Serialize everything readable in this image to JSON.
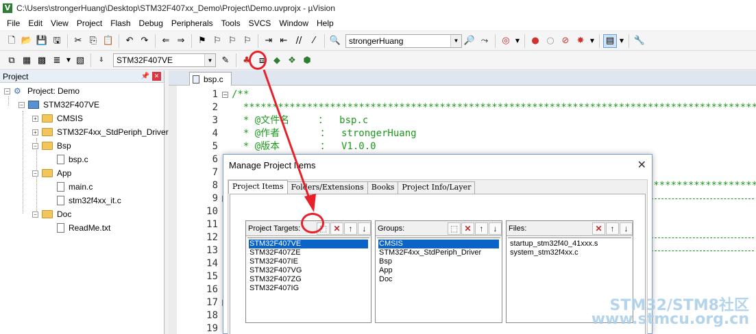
{
  "window": {
    "title": "C:\\Users\\strongerHuang\\Desktop\\STM32F407xx_Demo\\Project\\Demo.uvprojx - µVision"
  },
  "menu": [
    "File",
    "Edit",
    "View",
    "Project",
    "Flash",
    "Debug",
    "Peripherals",
    "Tools",
    "SVCS",
    "Window",
    "Help"
  ],
  "toolbar": {
    "user_combo": "strongerHuang",
    "target_combo": "STM32F407VE"
  },
  "project_panel": {
    "title": "Project",
    "tree": {
      "root": "Project: Demo",
      "target": "STM32F407VE",
      "groups": [
        "CMSIS",
        "STM32F4xx_StdPeriph_Driver",
        "Bsp",
        "App",
        "Doc"
      ],
      "bsp_files": [
        "bsp.c"
      ],
      "app_files": [
        "main.c",
        "stm32f4xx_it.c"
      ],
      "doc_files": [
        "ReadMe.txt"
      ]
    }
  },
  "editor": {
    "tab": "bsp.c",
    "line_numbers": [
      "1",
      "2",
      "3",
      "4",
      "5",
      "6",
      "7",
      "8",
      "9",
      "10",
      "11",
      "12",
      "13",
      "14",
      "15",
      "16",
      "17",
      "18",
      "19"
    ],
    "code": {
      "l1": "/**",
      "l2": "  **********************************************************************************************",
      "l3": "  * @文件名     ：  bsp.c",
      "l4": "  * @作者       ：  strongerHuang",
      "l5": "  * @版本       ：  V1.0.0",
      "l8": "  **********************************************************************************************"
    }
  },
  "dialog": {
    "title": "Manage Project Items",
    "tabs": [
      "Project Items",
      "Folders/Extensions",
      "Books",
      "Project Info/Layer"
    ],
    "targets": {
      "label": "Project Targets:",
      "items": [
        "STM32F407VE",
        "STM32F407ZE",
        "STM32F407IE",
        "STM32F407VG",
        "STM32F407ZG",
        "STM32F407IG"
      ]
    },
    "groups": {
      "label": "Groups:",
      "items": [
        "CMSIS",
        "STM32F4xx_StdPeriph_Driver",
        "Bsp",
        "App",
        "Doc"
      ]
    },
    "files": {
      "label": "Files:",
      "items": [
        "startup_stm32f40_41xxx.s",
        "system_stm32f4xx.c"
      ]
    }
  },
  "watermark": {
    "line1": "STM32/STM8社区",
    "line2": "www.stmcu.org.cn"
  },
  "colors": {
    "accent": "#0a64c8",
    "highlight": "#e8202a",
    "code": "#1a9a1a"
  }
}
